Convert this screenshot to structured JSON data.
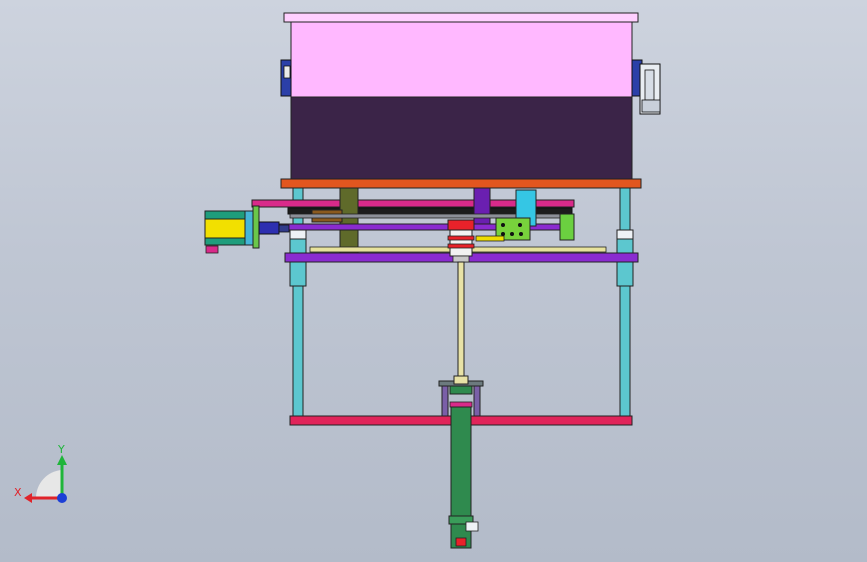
{
  "viewport": {
    "background_top": "#cdd3de",
    "background_bottom": "#b3bbc9"
  },
  "triad": {
    "x_label": "X",
    "y_label": "Y",
    "x_color": "#e0232a",
    "y_color": "#1fb53a",
    "z_color": "#1c3fd6"
  },
  "colors": {
    "hopper_top": "#ffb8ff",
    "hopper_bottom": "#3b2448",
    "plate_orange": "#e2561f",
    "column": "#5cc7cf",
    "purple_rail": "#8a2bd0",
    "magenta_bar": "#d92a8a",
    "cylinder": "#2f8a4e",
    "base_plate": "#e0245a",
    "yellow_motor": "#f2e000",
    "rod": "#e8e2a6"
  }
}
